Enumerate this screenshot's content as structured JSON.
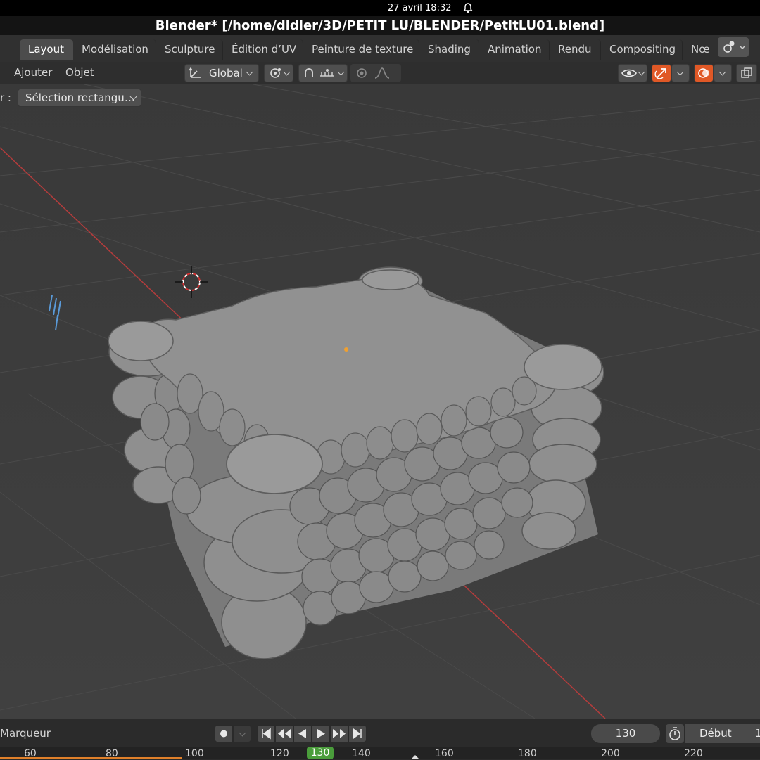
{
  "system": {
    "date_time": "27 avril  18:32"
  },
  "window": {
    "title": "Blender* [/home/didier/3D/PETIT LU/BLENDER/PetitLU01.blend]"
  },
  "workspaces": [
    {
      "label": "Layout",
      "active": true
    },
    {
      "label": "Modélisation"
    },
    {
      "label": "Sculpture"
    },
    {
      "label": "Édition d’UV"
    },
    {
      "label": "Peinture de texture"
    },
    {
      "label": "Shading"
    },
    {
      "label": "Animation"
    },
    {
      "label": "Rendu"
    },
    {
      "label": "Compositing"
    },
    {
      "label": "Nœ"
    }
  ],
  "header": {
    "menu_add": "Ajouter",
    "menu_object": "Objet",
    "orientation": "Global"
  },
  "toolbar": {
    "mode_prefix": "r :",
    "selection_mode": "Sélection rectangu…"
  },
  "timeline": {
    "marker_label": "Marqueur",
    "current_frame": "130",
    "start_label": "Début",
    "start_value": "1",
    "ruler_ticks": [
      "60",
      "80",
      "100",
      "120",
      "130",
      "140",
      "160",
      "180",
      "200",
      "220"
    ]
  },
  "colors": {
    "accent_orange": "#e05826",
    "current_frame_green": "#4a9d3b",
    "x_axis_red": "#b43c3c"
  }
}
